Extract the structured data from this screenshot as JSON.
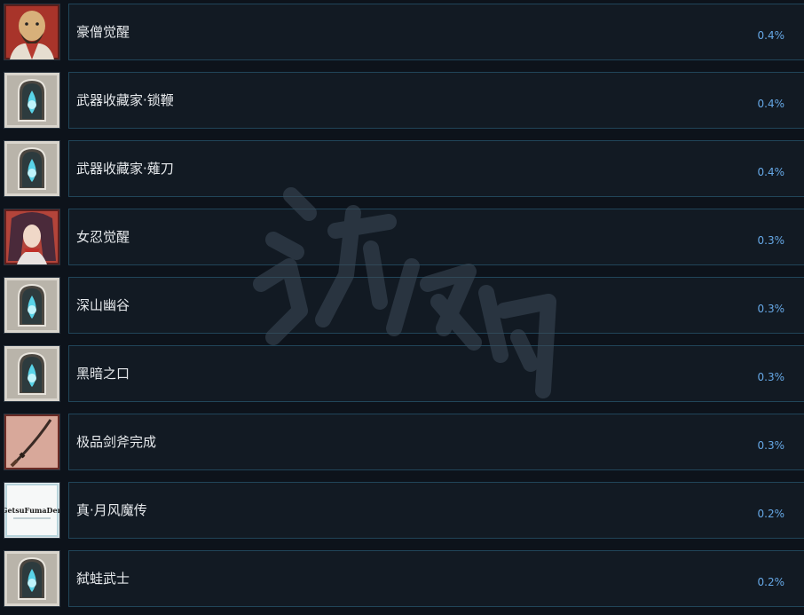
{
  "achievements": [
    {
      "name": "豪僧觉醒",
      "percent": "0.4%",
      "icon": "monk-portrait-icon"
    },
    {
      "name": "武器收藏家·锁鞭",
      "percent": "0.4%",
      "icon": "spirit-shrine-icon"
    },
    {
      "name": "武器收藏家·薙刀",
      "percent": "0.4%",
      "icon": "spirit-shrine-icon"
    },
    {
      "name": "女忍觉醒",
      "percent": "0.3%",
      "icon": "kunoichi-portrait-icon"
    },
    {
      "name": "深山幽谷",
      "percent": "0.3%",
      "icon": "spirit-shrine-icon"
    },
    {
      "name": "黑暗之口",
      "percent": "0.3%",
      "icon": "spirit-shrine-icon"
    },
    {
      "name": "极品剑斧完成",
      "percent": "0.3%",
      "icon": "sword-icon"
    },
    {
      "name": "真·月风魔传",
      "percent": "0.2%",
      "icon": "game-logo-icon",
      "icon_text": "GetsuFumaDen"
    },
    {
      "name": "弑蛙武士",
      "percent": "0.2%",
      "icon": "spirit-shrine-icon"
    }
  ],
  "colors": {
    "background": "#0d131b",
    "panel": "#121a23",
    "panel_border": "#214559",
    "name_text": "#e6e9ec",
    "percent_text": "#66a8e6"
  }
}
